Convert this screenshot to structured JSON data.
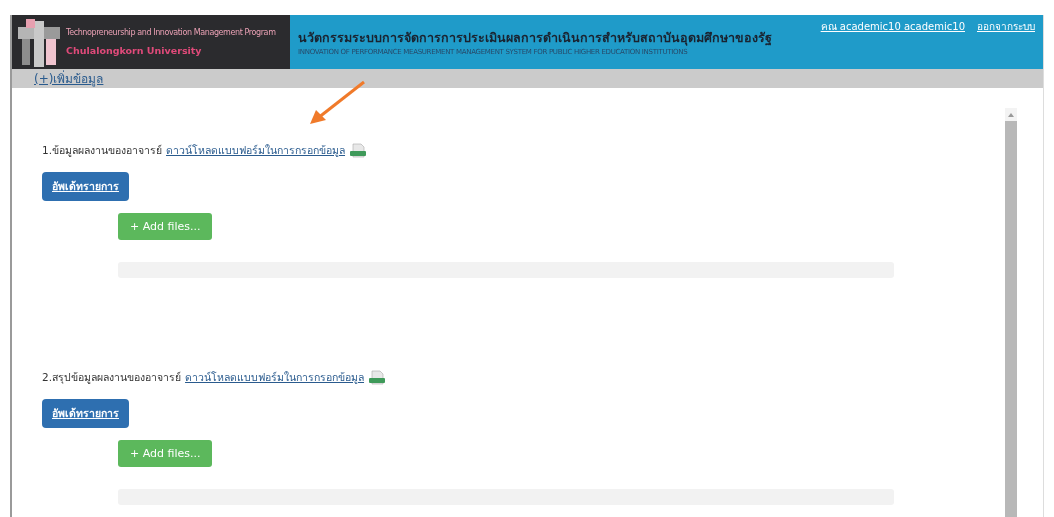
{
  "header": {
    "logo_line1": "Technopreneurship and Innovation Management Program",
    "logo_line2": "Chulalongkorn University",
    "title_th": "นวัตกรรมระบบการจัดการการประเมินผลการดำเนินการสำหรับสถาบันอุดมศึกษาของรัฐ",
    "title_en": "INNOVATION OF PERFORMANCE MEASUREMENT MANAGEMENT SYSTEM FOR PUBLIC HIGHER EDUCATION INSTITUTIONS",
    "user_link": "คณ academic10 academic10",
    "logout_link": "ออกจากระบบ"
  },
  "toolbar": {
    "add_link": "(+)เพิ่มข้อมูล"
  },
  "sections": [
    {
      "title": "1.ข้อมูลผลงานของอาจารย์",
      "download_link": "ดาวน์โหลดแบบฟอร์มในการกรอกข้อมูล",
      "update_button": "อัพเด้ทรายการ",
      "add_files_button": "+ Add files...",
      "has_progress_bar": true
    },
    {
      "title": "2.สรุปข้อมูลผลงานของอาจารย์",
      "download_link": "ดาวน์โหลดแบบฟอร์มในการกรอกข้อมูล",
      "update_button": "อัพเด้ทรายการ",
      "add_files_button": "+ Add files...",
      "has_progress_bar": true
    }
  ]
}
